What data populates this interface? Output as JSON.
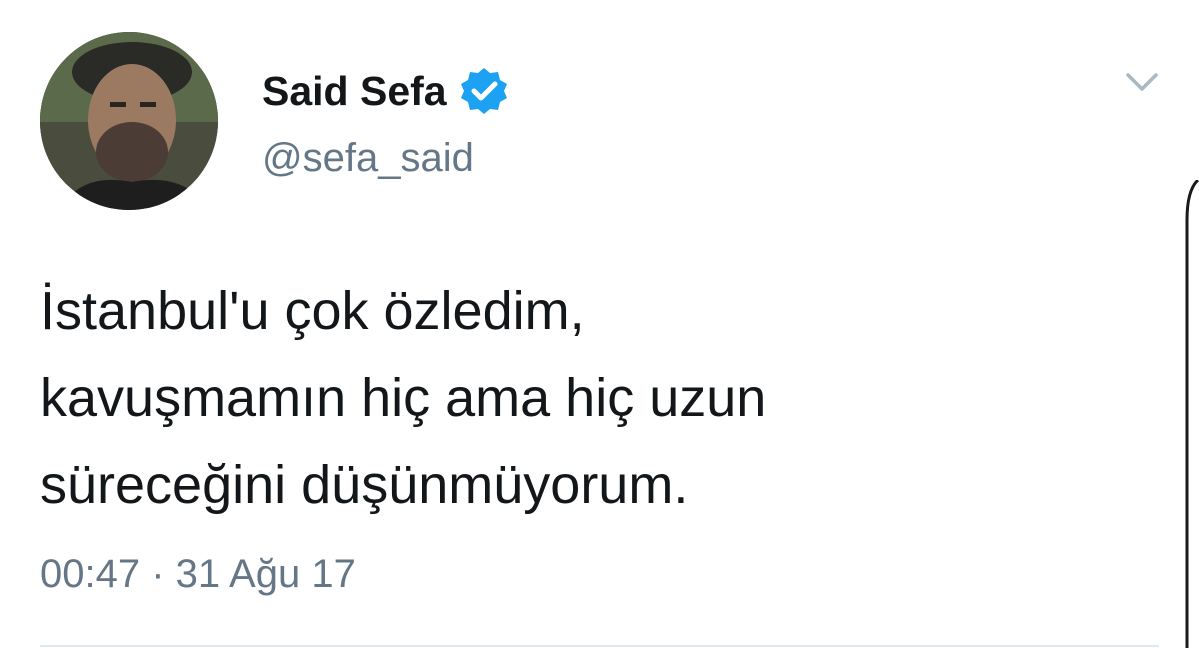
{
  "tweet": {
    "author": {
      "name": "Said Sefa",
      "handle": "@sefa_said",
      "verified": true,
      "avatar_icon": "profile-photo",
      "verified_icon": "verified-badge-icon"
    },
    "text_lines": [
      "İstanbul'u çok özledim,",
      "kavuşmamın hiç ama hiç uzun",
      "süreceğini düşünmüyorum."
    ],
    "timestamp": "00:47 · 31 Ağu 17",
    "menu_icon": "chevron-down-icon"
  },
  "colors": {
    "text_primary": "#14171a",
    "text_secondary": "#657786",
    "verified_blue": "#1da1f2",
    "chevron_gray": "#aab8c2",
    "divider": "#e1e8ed"
  }
}
